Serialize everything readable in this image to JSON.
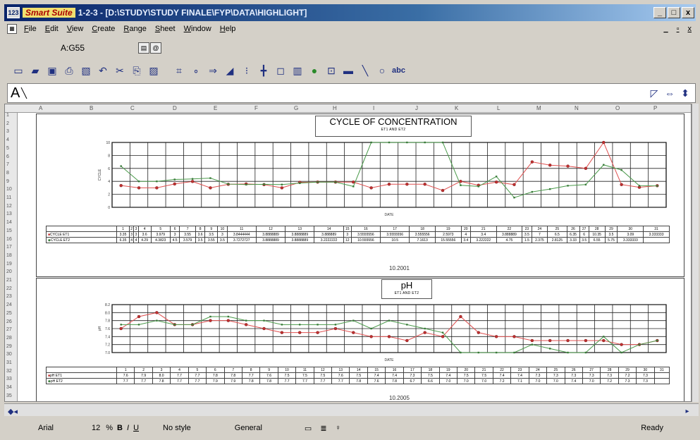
{
  "window": {
    "brand": "Smart Suite",
    "title": "1-2-3 - [D:\\STUDY\\STUDY FINALE\\FYP\\DATA\\HIGHLIGHT]",
    "controls": [
      "_",
      "□",
      "x"
    ]
  },
  "menu": {
    "items": [
      "File",
      "Edit",
      "View",
      "Create",
      "Range",
      "Sheet",
      "Window",
      "Help"
    ],
    "right_controls": [
      "_",
      "▫",
      "x"
    ]
  },
  "cell_ref": "A:G55",
  "sheet_tab": "A",
  "toolbar": {
    "icons": [
      "new-icon",
      "open-icon",
      "save-icon",
      "print-icon",
      "preview-icon",
      "undo-icon",
      "cut-icon",
      "copy-icon",
      "paste-icon",
      "chart-icon",
      "map-icon",
      "arrow-icon",
      "sort-icon",
      "fill-icon",
      "frame-icon",
      "bar-chart-icon",
      "globe-icon",
      "text-icon",
      "line-icon",
      "ellipse-icon"
    ],
    "text_tool": "abc"
  },
  "columns": [
    "A",
    "B",
    "C",
    "D",
    "E",
    "F",
    "G",
    "H",
    "I",
    "J",
    "K",
    "L",
    "M",
    "N",
    "O",
    "P"
  ],
  "rows": [
    "1",
    "2",
    "3",
    "4",
    "5",
    "6",
    "7",
    "8",
    "9",
    "10",
    "11",
    "12",
    "13",
    "14",
    "15",
    "16",
    "17",
    "18",
    "19",
    "20",
    "21",
    "22",
    "23",
    "24",
    "25",
    "26",
    "27",
    "28",
    "29",
    "30",
    "31",
    "32",
    "33",
    "34",
    "35"
  ],
  "chart1": {
    "title": "CYCLE OF CONCENTRATION",
    "subtitle": "ET1 AND ET2",
    "ylabel": "CYCLE",
    "xlabel": "DATE",
    "period": "10.2001",
    "series_labels": [
      "CYCLE ET1",
      "CYCLE ET2"
    ],
    "days": [
      "1",
      "2",
      "3",
      "4",
      "5",
      "6",
      "7",
      "8",
      "9",
      "10",
      "11",
      "12",
      "13",
      "14",
      "15",
      "16",
      "17",
      "18",
      "19",
      "20",
      "21",
      "22",
      "23",
      "24",
      "25",
      "26",
      "27",
      "28",
      "29",
      "30",
      "31"
    ],
    "row1": [
      "3.35",
      "3",
      "3",
      "3.6",
      "3.979",
      "3",
      "3.55",
      "3.6",
      "3.5",
      "3",
      "3.8444444",
      "3.8888889",
      "3.8888889",
      "3.888889",
      "3",
      "3.5555556",
      "3.5555556",
      "3.555556",
      "2.5973",
      "4",
      "3.4",
      "3.888889",
      "3.5",
      "7",
      "6.5",
      "6.35",
      "6",
      "10.35",
      "3.5",
      "3.09",
      "3.333333"
    ],
    "row2": [
      "6.35",
      "4",
      "4",
      "4.29",
      "4.3823",
      "4.5",
      "3.579",
      "3.5",
      "3.55",
      "3.5",
      "3.7272727",
      "3.8888889",
      "3.8888889",
      "3.2222222",
      "12",
      "10.555556",
      "10.5",
      "7.1613",
      "15.55556",
      "3.4",
      "3.222222",
      "4.75",
      "1.5",
      "2.375",
      "2.8125",
      "3.33",
      "3.5",
      "6.55",
      "5.75",
      "3.333333",
      ""
    ]
  },
  "chart2": {
    "title": "pH",
    "subtitle": "ET1 AND ET2",
    "ylabel": "pH",
    "xlabel": "DATE",
    "period": "10.2005",
    "series_labels": [
      "pH ET1",
      "pH ET2"
    ],
    "days": [
      "1",
      "2",
      "3",
      "4",
      "5",
      "6",
      "7",
      "8",
      "9",
      "10",
      "11",
      "12",
      "13",
      "14",
      "15",
      "16",
      "17",
      "18",
      "19",
      "20",
      "21",
      "22",
      "23",
      "24",
      "25",
      "26",
      "27",
      "28",
      "29",
      "30",
      "31"
    ],
    "row1": [
      "7.6",
      "7.9",
      "8.0",
      "7.7",
      "7.7",
      "7.8",
      "7.8",
      "7.7",
      "7.6",
      "7.5",
      "7.5",
      "7.5",
      "7.6",
      "7.5",
      "7.4",
      "7.4",
      "7.3",
      "7.5",
      "7.4",
      "7.5",
      "7.5",
      "7.4",
      "7.4",
      "7.3",
      "7.3",
      "7.3",
      "7.3",
      "7.3",
      "7.2",
      "7.3",
      ""
    ],
    "row2": [
      "7.7",
      "7.7",
      "7.8",
      "7.7",
      "7.7",
      "7.9",
      "7.9",
      "7.8",
      "7.8",
      "7.7",
      "7.7",
      "7.7",
      "7.7",
      "7.8",
      "7.6",
      "7.8",
      "6.7",
      "6.6",
      "7.0",
      "7.0",
      "7.0",
      "7.2",
      "7.1",
      "7.0",
      "7.0",
      "7.4",
      "7.0",
      "7.2",
      "7.3",
      "7.3",
      ""
    ]
  },
  "status": {
    "font": "Arial",
    "size": "12",
    "style": "No style",
    "format": "General",
    "ready": "Ready"
  },
  "chart_data": [
    {
      "type": "line",
      "title": "CYCLE OF CONCENTRATION",
      "subtitle": "ET1 AND ET2",
      "xlabel": "DATE",
      "ylabel": "CYCLE",
      "ylim": [
        0,
        10
      ],
      "yticks": [
        0,
        2,
        4,
        6,
        8,
        10
      ],
      "grid": true,
      "x": [
        1,
        2,
        3,
        4,
        5,
        6,
        7,
        8,
        9,
        10,
        11,
        12,
        13,
        14,
        15,
        16,
        17,
        18,
        19,
        20,
        21,
        22,
        23,
        24,
        25,
        26,
        27,
        28,
        29,
        30,
        31
      ],
      "series": [
        {
          "name": "CYCLE ET1",
          "color": "#e05050",
          "values": [
            3.35,
            3,
            3,
            3.6,
            3.979,
            3,
            3.55,
            3.6,
            3.5,
            3,
            3.84,
            3.89,
            3.89,
            3.89,
            3,
            3.56,
            3.56,
            3.56,
            2.6,
            4,
            3.4,
            3.89,
            3.5,
            7,
            6.5,
            6.35,
            6,
            10,
            3.5,
            3.09,
            3.33
          ]
        },
        {
          "name": "CYCLE ET2",
          "color": "#4a9a4a",
          "values": [
            6.35,
            4,
            4,
            4.29,
            4.38,
            4.5,
            3.58,
            3.5,
            3.55,
            3.5,
            3.73,
            3.89,
            3.89,
            3.22,
            10,
            10,
            10,
            10,
            10,
            3.4,
            3.22,
            4.75,
            1.5,
            2.38,
            2.81,
            3.33,
            3.5,
            6.55,
            5.75,
            3.33,
            3.3
          ]
        }
      ]
    },
    {
      "type": "line",
      "title": "pH",
      "subtitle": "ET1 AND ET2",
      "xlabel": "DATE",
      "ylabel": "pH",
      "ylim": [
        7,
        8.2
      ],
      "yticks": [
        7,
        7.2,
        7.4,
        7.6,
        7.8,
        8,
        8.2
      ],
      "grid": true,
      "x": [
        1,
        2,
        3,
        4,
        5,
        6,
        7,
        8,
        9,
        10,
        11,
        12,
        13,
        14,
        15,
        16,
        17,
        18,
        19,
        20,
        21,
        22,
        23,
        24,
        25,
        26,
        27,
        28,
        29,
        30,
        31
      ],
      "series": [
        {
          "name": "pH ET1",
          "color": "#e05050",
          "values": [
            7.6,
            7.9,
            8.0,
            7.7,
            7.7,
            7.8,
            7.8,
            7.7,
            7.6,
            7.5,
            7.5,
            7.5,
            7.6,
            7.5,
            7.4,
            7.4,
            7.3,
            7.5,
            7.4,
            7.9,
            7.5,
            7.4,
            7.4,
            7.3,
            7.3,
            7.3,
            7.3,
            7.3,
            7.2,
            7.2,
            7.3
          ]
        },
        {
          "name": "pH ET2",
          "color": "#4a9a4a",
          "values": [
            7.7,
            7.7,
            7.8,
            7.7,
            7.7,
            7.9,
            7.9,
            7.8,
            7.8,
            7.7,
            7.7,
            7.7,
            7.7,
            7.8,
            7.6,
            7.8,
            7.7,
            7.6,
            7.5,
            7.0,
            7.0,
            7.0,
            7.0,
            7.2,
            7.1,
            7.0,
            7.0,
            7.4,
            7.0,
            7.2,
            7.3
          ]
        }
      ]
    }
  ]
}
